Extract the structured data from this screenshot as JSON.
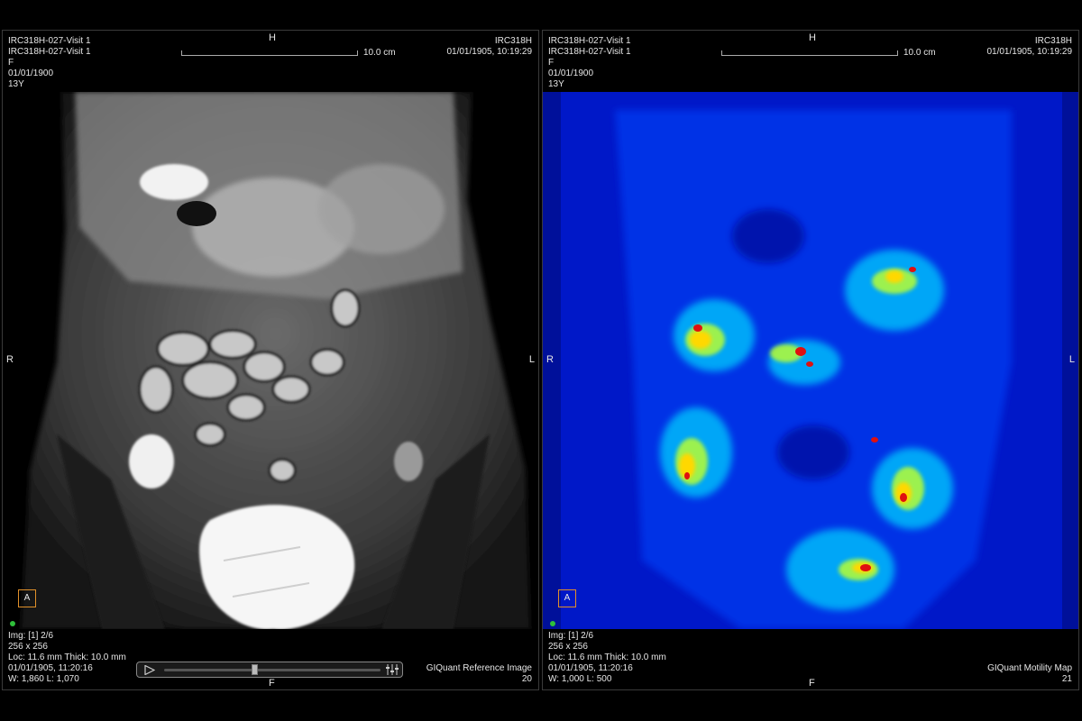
{
  "left_viewport": {
    "top_left": [
      "IRC318H-027-Visit 1",
      "IRC318H-027-Visit 1",
      "F",
      "01/01/1900",
      "13Y"
    ],
    "top_right": [
      "IRC318H",
      "01/01/1905, 10:19:29"
    ],
    "orientation": {
      "top": "H",
      "bottom": "F",
      "left": "R",
      "right": "L"
    },
    "scale_label": "10.0 cm",
    "anterior_marker": "A",
    "bottom_left": [
      "Img: [1] 2/6",
      "256 x 256",
      "Loc: 11.6 mm Thick: 10.0 mm",
      "01/01/1905, 11:20:16",
      "W: 1,860 L: 1,070"
    ],
    "bottom_right": [
      "GIQuant Reference Image",
      "20"
    ],
    "cine": {
      "position": 0.42
    }
  },
  "right_viewport": {
    "top_left": [
      "IRC318H-027-Visit 1",
      "IRC318H-027-Visit 1",
      "F",
      "01/01/1900",
      "13Y"
    ],
    "top_right": [
      "IRC318H",
      "01/01/1905, 10:19:29"
    ],
    "orientation": {
      "top": "H",
      "bottom": "F",
      "left": "R",
      "right": "L"
    },
    "scale_label": "10.0 cm",
    "anterior_marker": "A",
    "bottom_left": [
      "Img: [1] 2/6",
      "256 x 256",
      "Loc: 11.6 mm Thick: 10.0 mm",
      "01/01/1905, 11:20:16",
      "W: 1,000 L: 500"
    ],
    "bottom_right": [
      "GIQuant Motility Map",
      "21"
    ]
  },
  "colors": {
    "status_dot": "#2fbf3a",
    "marker_border": "#e0902a",
    "colormap_low": "#0010c8",
    "colormap_high": "#e01010"
  },
  "icons": [
    "play-icon",
    "cine-settings-icon"
  ]
}
